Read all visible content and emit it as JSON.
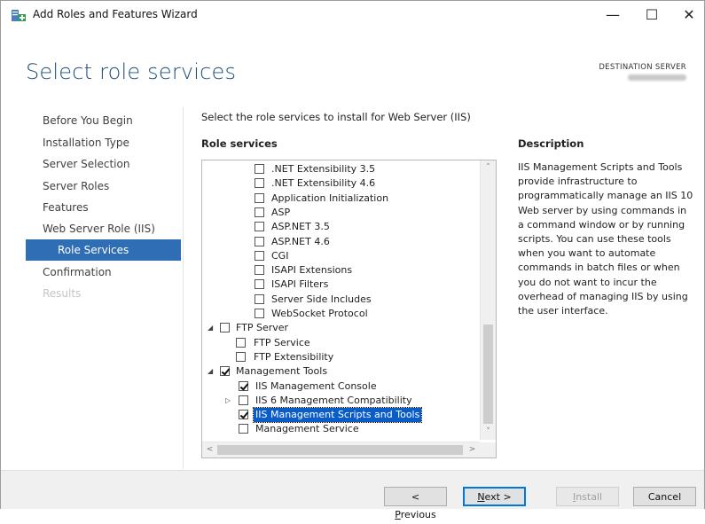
{
  "window": {
    "title": "Add Roles and Features Wizard",
    "controls": {
      "minimize": "—",
      "maximize": "☐",
      "close": "✕"
    }
  },
  "page": {
    "title": "Select role services",
    "destination_label": "DESTINATION SERVER"
  },
  "nav": {
    "items": [
      {
        "label": "Before You Begin"
      },
      {
        "label": "Installation Type"
      },
      {
        "label": "Server Selection"
      },
      {
        "label": "Server Roles"
      },
      {
        "label": "Features"
      },
      {
        "label": "Web Server Role (IIS)"
      },
      {
        "label": "Role Services"
      },
      {
        "label": "Confirmation"
      },
      {
        "label": "Results"
      }
    ]
  },
  "content": {
    "instruction": "Select the role services to install for Web Server (IIS)",
    "role_services_header": "Role services",
    "tree": [
      {
        "label": ".NET Extensibility 3.5",
        "checked": false
      },
      {
        "label": ".NET Extensibility 4.6",
        "checked": false
      },
      {
        "label": "Application Initialization",
        "checked": false
      },
      {
        "label": "ASP",
        "checked": false
      },
      {
        "label": "ASP.NET 3.5",
        "checked": false
      },
      {
        "label": "ASP.NET 4.6",
        "checked": false
      },
      {
        "label": "CGI",
        "checked": false
      },
      {
        "label": "ISAPI Extensions",
        "checked": false
      },
      {
        "label": "ISAPI Filters",
        "checked": false
      },
      {
        "label": "Server Side Includes",
        "checked": false
      },
      {
        "label": "WebSocket Protocol",
        "checked": false
      },
      {
        "label": "FTP Server",
        "checked": false,
        "expander": "◢"
      },
      {
        "label": "FTP Service",
        "checked": false
      },
      {
        "label": "FTP Extensibility",
        "checked": false
      },
      {
        "label": "Management Tools",
        "checked": true,
        "expander": "◢"
      },
      {
        "label": "IIS Management Console",
        "checked": true
      },
      {
        "label": "IIS 6 Management Compatibility",
        "checked": false,
        "expander": "▷"
      },
      {
        "label": "IIS Management Scripts and Tools",
        "checked": true,
        "selected": true
      },
      {
        "label": "Management Service",
        "checked": false
      }
    ]
  },
  "description": {
    "header": "Description",
    "text": "IIS Management Scripts and Tools provide infrastructure to programmatically manage an IIS 10 Web server by using commands in a command window or by running scripts. You can use these tools when you want to automate commands in batch files or when you do not want to incur the overhead of managing IIS by using the user interface."
  },
  "footer": {
    "previous": {
      "prefix": "< ",
      "key": "P",
      "rest": "revious"
    },
    "next": {
      "key": "N",
      "rest": "ext >"
    },
    "install": {
      "key": "I",
      "rest": "nstall"
    },
    "cancel": {
      "label": "Cancel"
    }
  },
  "icons": {
    "scroll_up": "˄",
    "scroll_down": "˅",
    "scroll_left": "<",
    "scroll_right": ">"
  },
  "colors": {
    "accent": "#2f6eb5",
    "selection": "#0a5cc8",
    "title": "#1f4e79"
  }
}
